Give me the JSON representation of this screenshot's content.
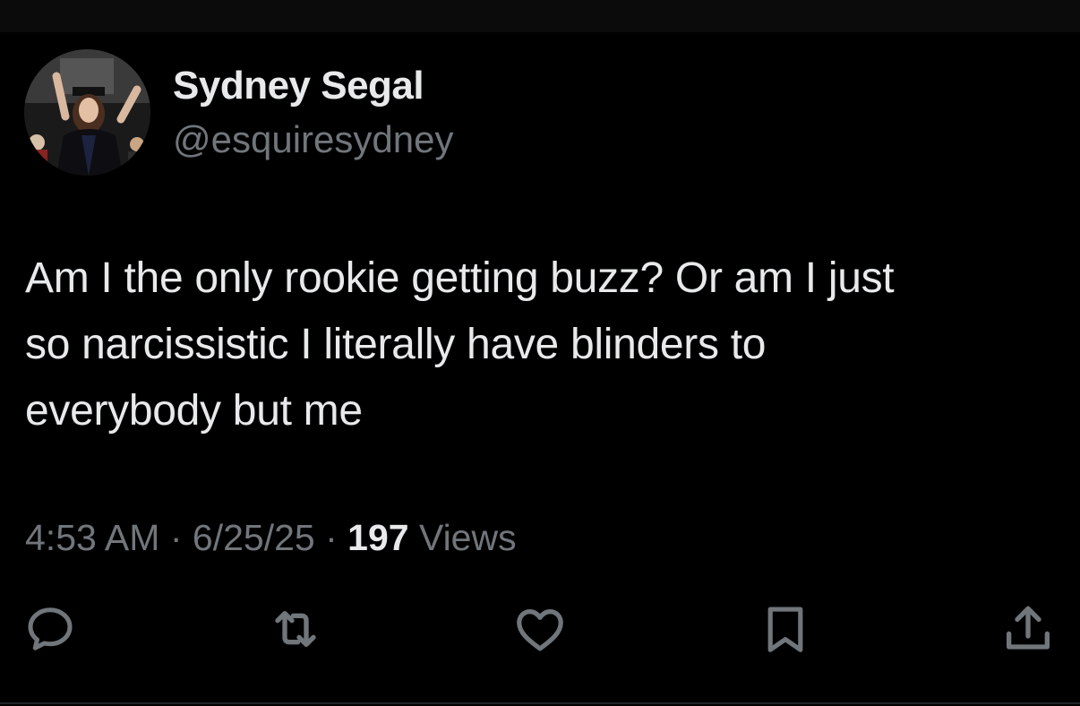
{
  "tweet": {
    "author": {
      "name": "Sydney Segal",
      "handle": "@esquiresydney"
    },
    "text_lines": [
      "Am I the only rookie getting buzz? Or am I just",
      "so narcissistic I literally have blinders to",
      "everybody but me"
    ],
    "meta": {
      "time": "4:53 AM",
      "separator": "·",
      "date": "6/25/25",
      "views_count": "197",
      "views_label": "Views"
    },
    "actions": [
      {
        "name": "reply",
        "icon": "speech-bubble-icon"
      },
      {
        "name": "retweet",
        "icon": "retweet-icon"
      },
      {
        "name": "like",
        "icon": "heart-icon"
      },
      {
        "name": "bookmark",
        "icon": "bookmark-icon"
      },
      {
        "name": "share",
        "icon": "share-icon"
      }
    ]
  },
  "colors": {
    "background": "#000000",
    "primary_text": "#e7e9ea",
    "secondary_text": "#71767b",
    "icon": "#71767b"
  }
}
